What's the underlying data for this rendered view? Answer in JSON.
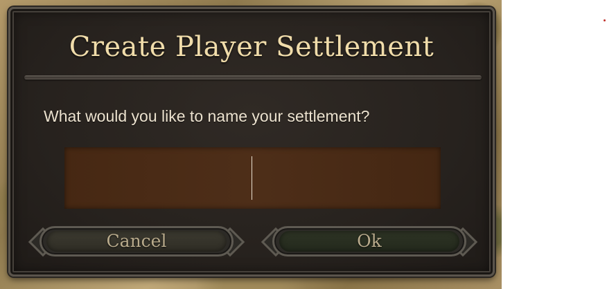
{
  "dialog": {
    "title": "Create Player Settlement",
    "prompt": "What would you like to name your settlement?",
    "name_input": {
      "value": "",
      "placeholder": ""
    },
    "buttons": {
      "cancel_label": "Cancel",
      "ok_label": "Ok"
    }
  },
  "colors": {
    "title_text": "#f0dcaa",
    "prompt_text": "#ece2cf",
    "input_bg": "#4a2a14",
    "button_text": "#b9ab8c",
    "dialog_bg": "#27221e"
  }
}
